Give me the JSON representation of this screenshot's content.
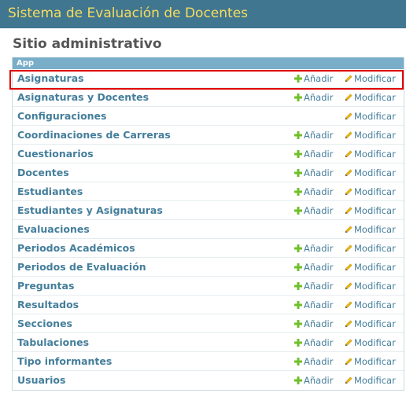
{
  "header": {
    "title": "Sistema de Evaluación de Docentes"
  },
  "page": {
    "title": "Sitio administrativo"
  },
  "module": {
    "caption": "App",
    "add_label": "Añadir",
    "change_label": "Modificar",
    "rows": [
      {
        "name": "Asignaturas",
        "add": true,
        "highlighted": true
      },
      {
        "name": "Asignaturas y Docentes",
        "add": true
      },
      {
        "name": "Configuraciones",
        "add": false
      },
      {
        "name": "Coordinaciones de Carreras",
        "add": true
      },
      {
        "name": "Cuestionarios",
        "add": true
      },
      {
        "name": "Docentes",
        "add": true
      },
      {
        "name": "Estudiantes",
        "add": true
      },
      {
        "name": "Estudiantes y Asignaturas",
        "add": true
      },
      {
        "name": "Evaluaciones",
        "add": false
      },
      {
        "name": "Periodos Académicos",
        "add": true
      },
      {
        "name": "Periodos de Evaluación",
        "add": true
      },
      {
        "name": "Preguntas",
        "add": true
      },
      {
        "name": "Resultados",
        "add": true
      },
      {
        "name": "Secciones",
        "add": true
      },
      {
        "name": "Tabulaciones",
        "add": true
      },
      {
        "name": "Tipo informantes",
        "add": true
      },
      {
        "name": "Usuarios",
        "add": true
      }
    ]
  },
  "colors": {
    "header_bg": "#417690",
    "header_text": "#f5dd5d",
    "caption_bg": "#79aec8",
    "link": "#447e9b",
    "add_icon": "#70bf2b",
    "change_icon": "#efb80b",
    "highlight": "#e00000"
  }
}
